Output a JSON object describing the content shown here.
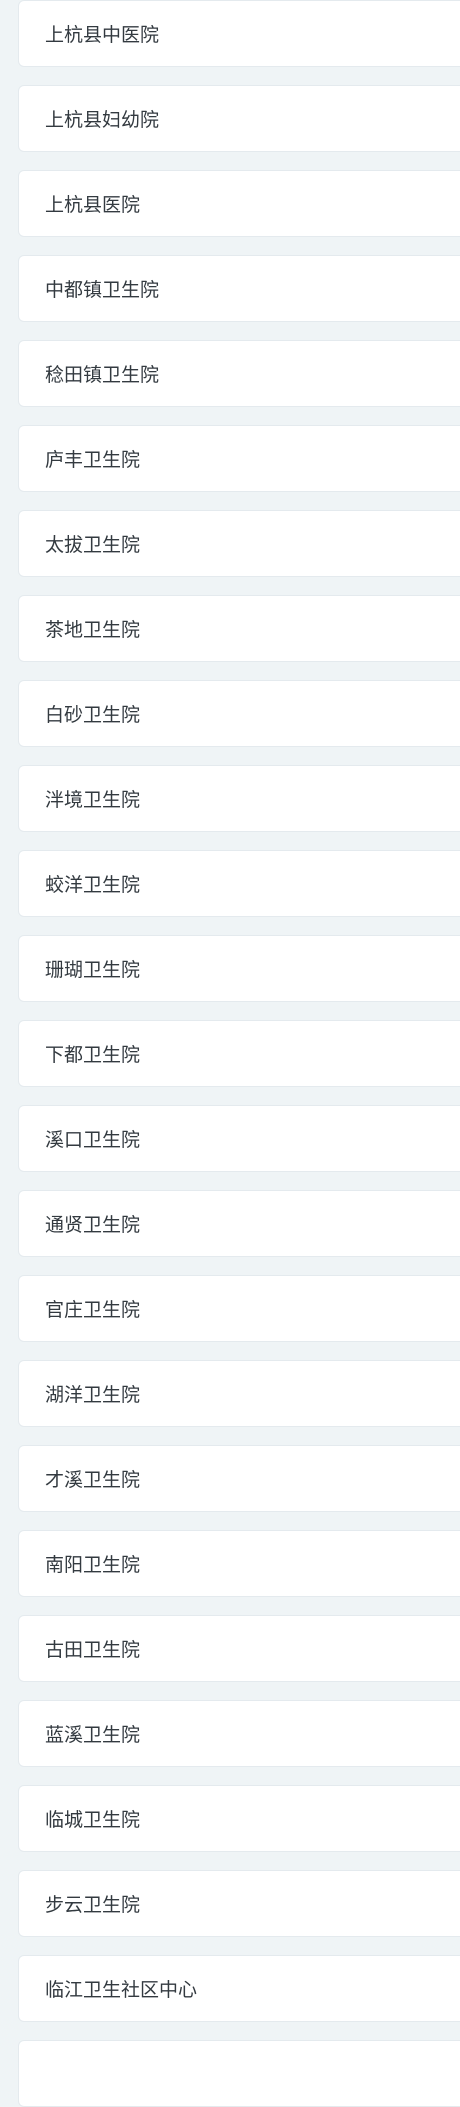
{
  "hospitals": [
    "上杭县中医院",
    "上杭县妇幼院",
    "上杭县医院",
    "中都镇卫生院",
    "稔田镇卫生院",
    "庐丰卫生院",
    "太拔卫生院",
    "茶地卫生院",
    "白砂卫生院",
    "泮境卫生院",
    "蛟洋卫生院",
    "珊瑚卫生院",
    "下都卫生院",
    "溪口卫生院",
    "通贤卫生院",
    "官庄卫生院",
    "湖洋卫生院",
    "才溪卫生院",
    "南阳卫生院",
    "古田卫生院",
    "蓝溪卫生院",
    "临城卫生院",
    "步云卫生院",
    "临江卫生社区中心",
    ""
  ]
}
